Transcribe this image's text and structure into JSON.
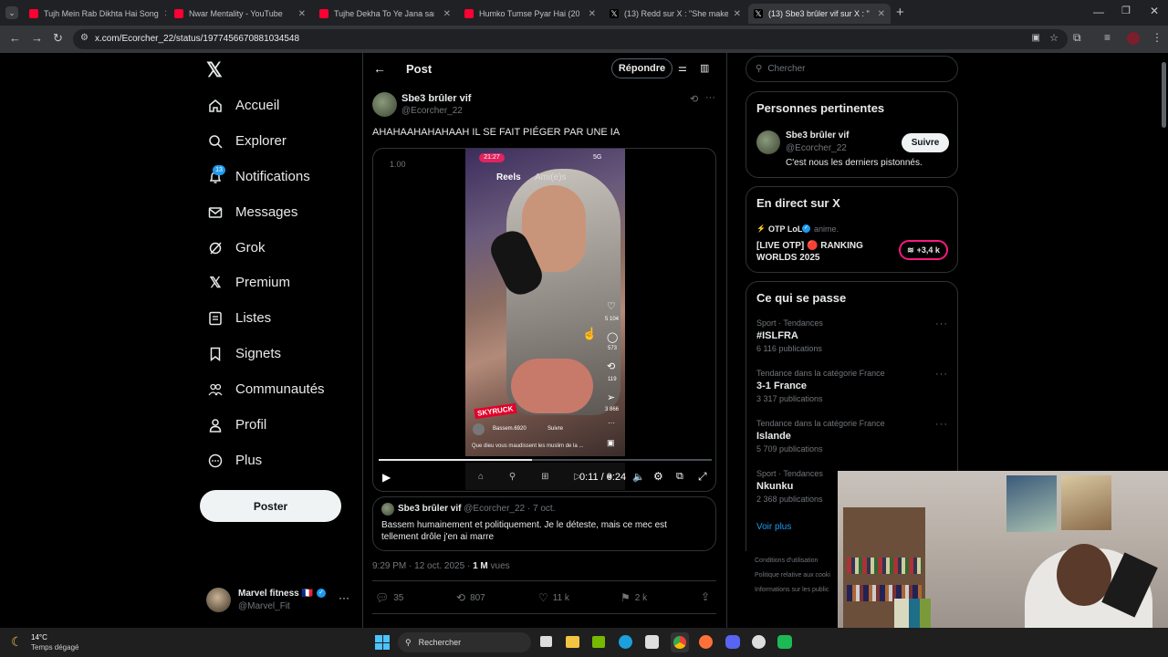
{
  "browser": {
    "tabs": [
      {
        "title": "Tujh Mein Rab Dikhta Hai Song"
      },
      {
        "title": "Nwar Mentality - YouTube"
      },
      {
        "title": "Tujhe Dekha To Ye Jana sanam"
      },
      {
        "title": "Humko Tumse Pyar Hai (2006)"
      },
      {
        "title": "(13) Redd sur X : \"She makes m"
      },
      {
        "title": "(13) Sbe3 brûler vif sur X : \""
      }
    ],
    "url": "x.com/Ecorcher_22/status/1977456670881034548"
  },
  "nav": {
    "items": [
      {
        "label": "Accueil",
        "badge": ""
      },
      {
        "label": "Explorer",
        "badge": ""
      },
      {
        "label": "Notifications",
        "badge": "13"
      },
      {
        "label": "Messages",
        "badge": ""
      },
      {
        "label": "Grok",
        "badge": ""
      },
      {
        "label": "Premium",
        "badge": ""
      },
      {
        "label": "Listes",
        "badge": ""
      },
      {
        "label": "Signets",
        "badge": ""
      },
      {
        "label": "Communautés",
        "badge": ""
      },
      {
        "label": "Profil",
        "badge": ""
      },
      {
        "label": "Plus",
        "badge": ""
      }
    ],
    "post_button": "Poster",
    "account": {
      "name": "Marvel fitness 🇫🇷",
      "handle": "@Marvel_Fit"
    }
  },
  "post": {
    "header_title": "Post",
    "reply_button": "Répondre",
    "author_name": "Sbe3 brûler vif",
    "author_handle": "@Ecorcher_22",
    "text": "AHAHAAHAHAHAAH IL SE FAIT PIÉGER PAR UNE IA",
    "video": {
      "speed_label": "1.00",
      "status_time": "21:27",
      "status_net": "5G",
      "reels_tab": "Reels",
      "friends_tab": "Ami(e)s",
      "counts": [
        "5 104",
        "573",
        "119",
        "3 866"
      ],
      "reel_user": "Bassem.6920",
      "reel_follow": "Suivre",
      "reel_caption": "Que dieu vous maudissent les muslim de la ...",
      "logo": "SKYRUCK",
      "time": "0:11 / 0:24",
      "progress": 0.46
    },
    "quoted": {
      "name": "Sbe3 brûler vif",
      "handle": "@Ecorcher_22",
      "date": "· 7 oct.",
      "text": "Bassem humainement et politiquement. Je le déteste, mais ce mec est tellement drôle j'en ai marre"
    },
    "meta_time": "9:29 PM · 12 oct. 2025 ·",
    "meta_views_count": "1 M",
    "meta_views_label": "vues",
    "stats": {
      "replies": "35",
      "reposts": "807",
      "likes": "11 k",
      "bookmarks": "2 k"
    }
  },
  "sidebar": {
    "search_placeholder": "Chercher",
    "relevant": {
      "title": "Personnes pertinentes",
      "name": "Sbe3 brûler vif",
      "handle": "@Ecorcher_22",
      "bio": "C'est nous les derniers pistonnés.",
      "follow": "Suivre"
    },
    "live": {
      "title": "En direct sur X",
      "host": "OTP LoL",
      "host_suffix": "anime.",
      "stream_title": "[LIVE OTP] 🔴 RANKING WORLDS 2025",
      "listeners": "+3,4 k"
    },
    "trends": {
      "title": "Ce qui se passe",
      "items": [
        {
          "context": "Sport · Tendances",
          "name": "#ISLFRA",
          "count": "6 116 publications"
        },
        {
          "context": "Tendance dans la catégorie France",
          "name": "3-1 France",
          "count": "3 317 publications"
        },
        {
          "context": "Tendance dans la catégorie France",
          "name": "Islande",
          "count": "5 709 publications"
        },
        {
          "context": "Sport · Tendances",
          "name": "Nkunku",
          "count": "2 368 publications"
        }
      ],
      "more": "Voir plus"
    },
    "footer": [
      "Conditions d'utilisation",
      "Politique relative aux cooki",
      "Informations sur les public"
    ]
  },
  "taskbar": {
    "temp": "14°C",
    "weather": "Temps dégagé",
    "search": "Rechercher"
  },
  "colors": {
    "accent": "#1d9bf0",
    "live_ring": "#f91880",
    "badge": "#1d9bf0"
  }
}
